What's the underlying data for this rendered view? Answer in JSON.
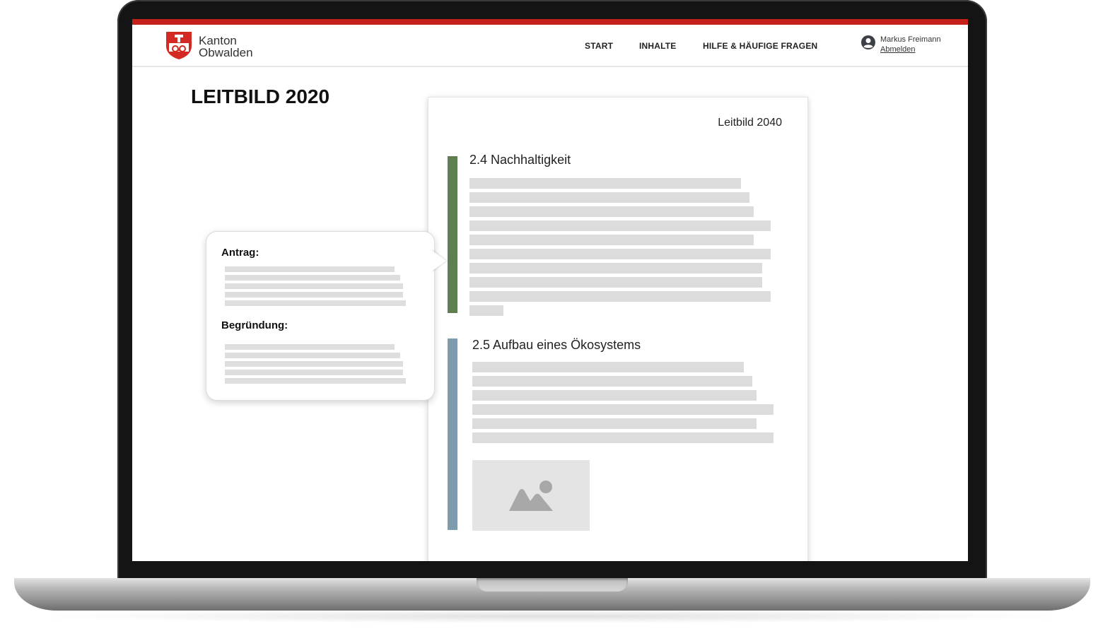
{
  "header": {
    "logo_line1": "Kanton",
    "logo_line2": "Obwalden",
    "nav": [
      "START",
      "INHALTE",
      "HILFE & HÄUFIGE FRAGEN"
    ],
    "user_name": "Markus Freimann",
    "logout_label": "Abmelden"
  },
  "page": {
    "title": "LEITBILD 2020"
  },
  "document": {
    "title": "Leitbild 2040",
    "sections": [
      {
        "heading": "2.4 Nachhaltigkeit",
        "bar_color": "#5f7f52"
      },
      {
        "heading": "2.5 Aufbau eines Ökosystems",
        "bar_color": "#7f9bae"
      }
    ]
  },
  "callout": {
    "label_antrag": "Antrag:",
    "label_begruendung": "Begründung:"
  },
  "icons": {
    "logo": "coat-of-arms-icon",
    "user": "user-account-icon",
    "image": "image-placeholder-icon"
  },
  "colors": {
    "brand_red": "#c4211a",
    "text_placeholder": "#dcdcdc"
  }
}
